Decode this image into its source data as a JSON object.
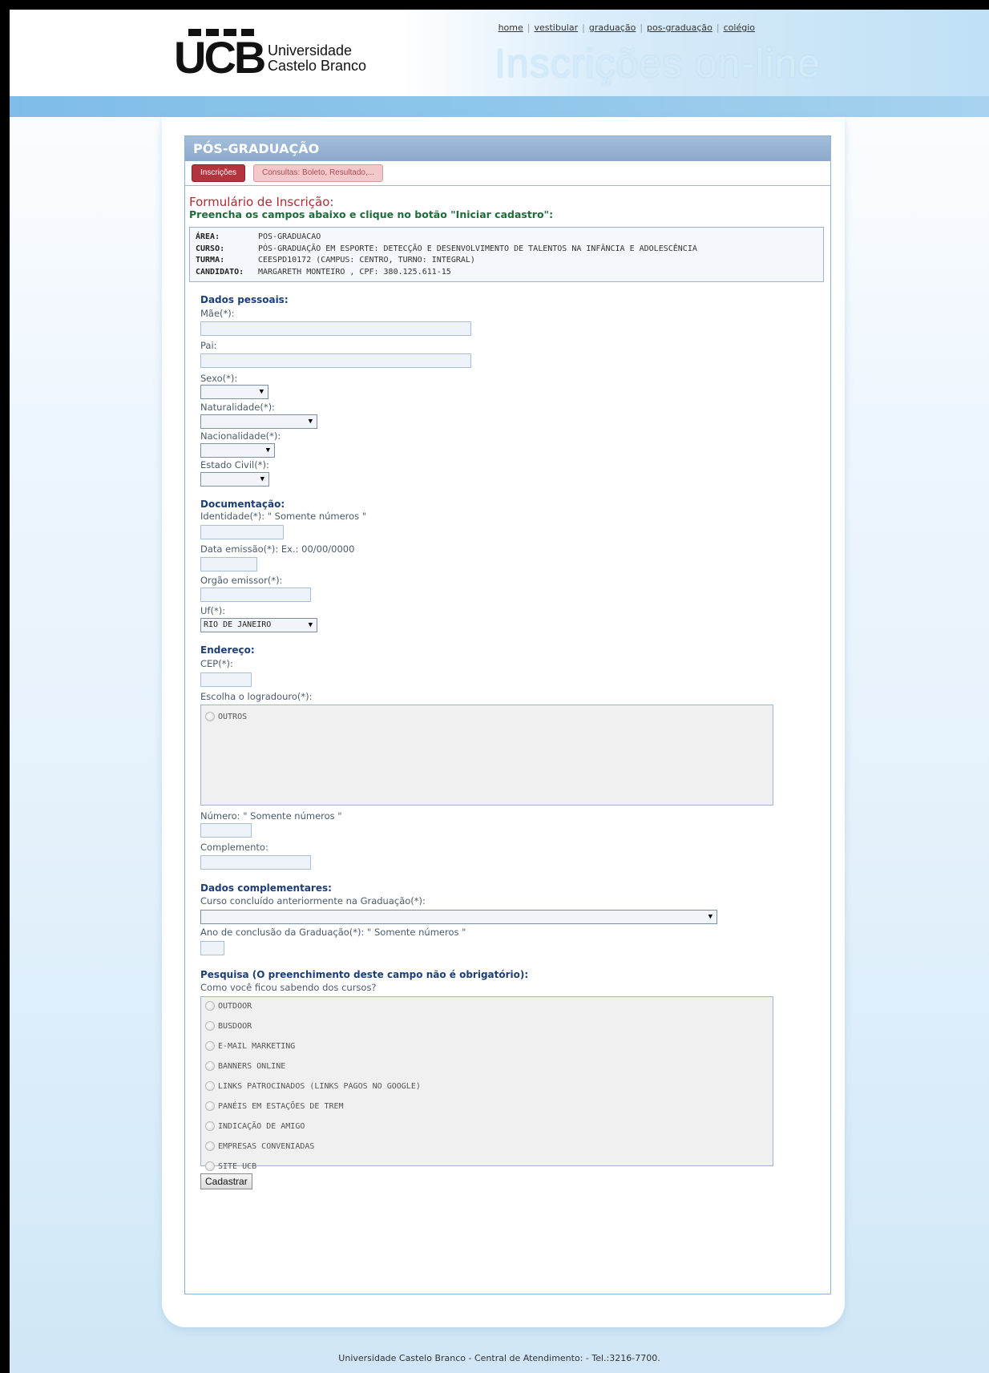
{
  "header": {
    "logo_text_line1": "Universidade",
    "logo_text_line2": "Castelo Branco",
    "logo_mark": "UCB",
    "tagline": "Inscrições on-line",
    "links": [
      "home",
      "vestibular",
      "graduação",
      "pos-graduação",
      "colégio"
    ],
    "link_separator": "|"
  },
  "page": {
    "section_title": "PÓS-GRADUAÇÃO",
    "tabs": [
      {
        "label": "Inscrições",
        "active": true
      },
      {
        "label": "Consultas: Boleto, Resultado,...",
        "active": false
      }
    ],
    "form_title": "Formulário de Inscrição:",
    "form_subtitle": "Preencha os campos abaixo e clique no botão \"Iniciar cadastro\":"
  },
  "info": [
    {
      "key": "ÁREA:",
      "value": "POS-GRADUACAO"
    },
    {
      "key": "CURSO:",
      "value": "PÓS-GRADUAÇÃO EM ESPORTE: DETECÇÃO E DESENVOLVIMENTO DE TALENTOS NA INFÂNCIA E ADOLESCÊNCIA"
    },
    {
      "key": "TURMA:",
      "value": "CEESPD10172 (CAMPUS: CENTRO, TURNO: INTEGRAL)"
    },
    {
      "key": "CANDIDATO:",
      "value": "MARGARETH MONTEIRO , CPF: 380.125.611-15"
    }
  ],
  "dados_pessoais": {
    "heading": "Dados pessoais:",
    "mae_label": "Mãe(*):",
    "pai_label": "Pai:",
    "sexo_label": "Sexo(*):",
    "naturalidade_label": "Naturalidade(*):",
    "nacionalidade_label": "Nacionalidade(*):",
    "estado_civil_label": "Estado Civil(*):"
  },
  "documentacao": {
    "heading": "Documentação:",
    "identidade_label": "Identidade(*): \" Somente números \"",
    "data_emissao_label": "Data emissão(*): Ex.: 00/00/0000",
    "orgao_label": "Orgão emissor(*):",
    "uf_label": "Uf(*):",
    "uf_value": "RIO DE JANEIRO"
  },
  "endereco": {
    "heading": "Endereço:",
    "cep_label": "CEP(*):",
    "logradouro_label": "Escolha o logradouro(*):",
    "logradouro_option": "OUTROS",
    "numero_label": "Número: \" Somente números \"",
    "complemento_label": "Complemento:"
  },
  "complementares": {
    "heading": "Dados complementares:",
    "curso_label": "Curso concluído anteriormente na Graduação(*):",
    "ano_label": "Ano de conclusão da Graduação(*): \" Somente números \""
  },
  "pesquisa": {
    "heading": "Pesquisa (O preenchimento deste campo não é obrigatório):",
    "question": "Como você ficou sabendo dos cursos?",
    "options": [
      "OUTDOOR",
      "BUSDOOR",
      "E-MAIL MARKETING",
      "BANNERS ONLINE",
      "LINKS PATROCINADOS (LINKS PAGOS NO GOOGLE)",
      "PANÉIS EM ESTAÇÕES DE TREM",
      "INDICAÇÃO DE AMIGO",
      "EMPRESAS CONVENIADAS",
      "SITE UCB"
    ]
  },
  "submit_label": "Cadastrar",
  "footer": "Universidade Castelo Branco - Central de Atendimento: - Tel.:3216-7700.",
  "colors": {
    "accent_red": "#b4343d",
    "title_bar": "#8ba9cc",
    "heading_blue": "#1c3e78",
    "subtitle_green": "#1d6d3a"
  }
}
